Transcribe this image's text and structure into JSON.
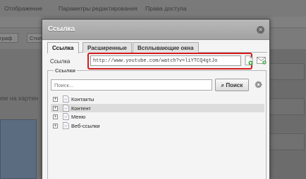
{
  "background": {
    "tabs": [
      "Отображение",
      "Параметры редактирования",
      "Права доступа"
    ],
    "toolbar": {
      "left_fragment": "граф",
      "style_fragment": "Стил"
    },
    "editor_text": "ем на картин"
  },
  "dialog": {
    "title": "Ссылка",
    "close_glyph": "×",
    "tabs": [
      "Ссылка",
      "Расширенные",
      "Всплывающие окна"
    ],
    "active_tab": "Ссылка",
    "link": {
      "label": "Ссылка",
      "value": "http://www.youtube.com/watch?v=liYTCQ4gtJo"
    },
    "links_section": {
      "legend": "Ссылки",
      "search_placeholder": "Поиск...",
      "search_button": "Поиск",
      "tree": [
        {
          "label": "Контакты",
          "selected": false
        },
        {
          "label": "Контент",
          "selected": true
        },
        {
          "label": "Меню",
          "selected": false
        },
        {
          "label": "Веб-ссылки",
          "selected": false
        }
      ]
    }
  },
  "colors": {
    "highlight": "#d21c1c",
    "overlay": "#6e6e6e"
  }
}
